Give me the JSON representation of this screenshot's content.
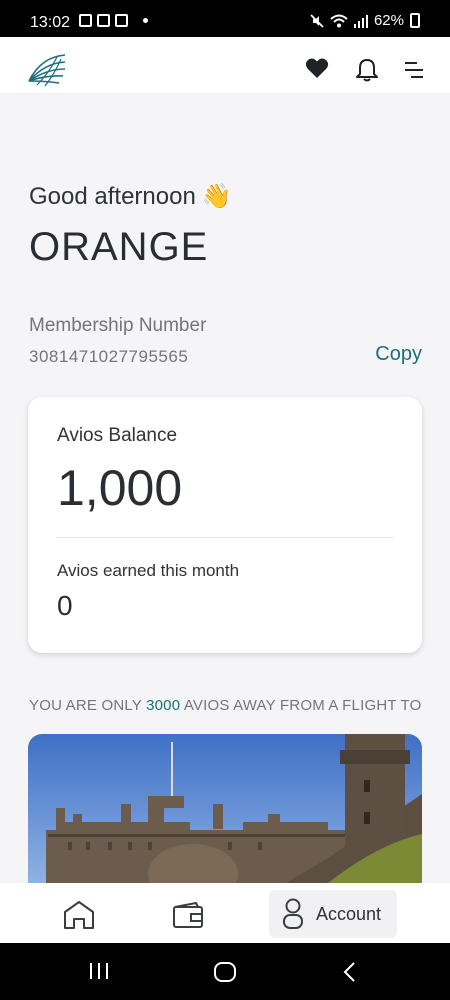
{
  "status_bar": {
    "time": "13:02",
    "battery": "62%"
  },
  "greeting": {
    "text": "Good afternoon",
    "emoji": "👋",
    "name": "ORANGE"
  },
  "membership": {
    "label": "Membership Number",
    "number": "3081471027795565",
    "copy_label": "Copy"
  },
  "balance_card": {
    "balance_label": "Avios Balance",
    "balance_value": "1,000",
    "earned_label": "Avios earned this month",
    "earned_value": "0"
  },
  "promo": {
    "prefix": "YOU ARE ONLY",
    "avios": "3000",
    "suffix": "AVIOS AWAY FROM A FLIGHT TO"
  },
  "bottom_nav": {
    "account_label": "Account"
  },
  "colors": {
    "accent": "#1b6f7c",
    "text": "#2f3338",
    "muted": "#72767b",
    "background": "#f5f5f7"
  },
  "icons": [
    "logo-icon",
    "heart-icon",
    "bell-icon",
    "menu-icon",
    "home-icon",
    "wallet-icon",
    "user-icon",
    "recent-apps-icon",
    "home-circle-icon",
    "back-icon"
  ]
}
